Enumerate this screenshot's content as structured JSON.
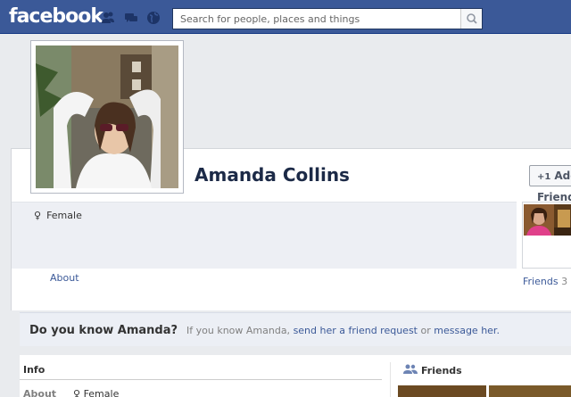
{
  "header": {
    "logo_text": "facebook",
    "search_placeholder": "Search for people, places and things",
    "icons": [
      "friend-requests-icon",
      "messages-icon",
      "notifications-globe-icon",
      "search-icon"
    ],
    "brand_color": "#3b5998"
  },
  "profile": {
    "name": "Amanda Collins",
    "add_friend_label": "Add Friend",
    "gender_symbol": "♀",
    "gender": "Female",
    "about_link": "About",
    "friends_link": "Friends",
    "friends_count": "3"
  },
  "know": {
    "title": "Do you know Amanda?",
    "text_prefix": "If you know Amanda,",
    "friend_request_link": "send her a friend request",
    "text_or": "or",
    "message_link": "message her.",
    "text_suffix": ""
  },
  "bottom": {
    "info_heading": "Info",
    "about_label": "About",
    "gender": "Female",
    "friends_heading": "Friends"
  }
}
